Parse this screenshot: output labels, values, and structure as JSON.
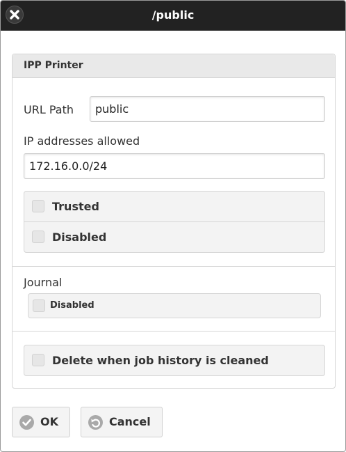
{
  "dialog": {
    "title": "/public",
    "close_icon": "close-icon"
  },
  "panel": {
    "heading": "IPP Printer",
    "url_path_label": "URL Path",
    "url_path_value": "public",
    "ip_label": "IP addresses allowed",
    "ip_value": "172.16.0.0/24",
    "options": [
      {
        "label": "Trusted",
        "checked": false
      },
      {
        "label": "Disabled",
        "checked": false
      }
    ],
    "journal": {
      "label": "Journal",
      "option": {
        "label": "Disabled",
        "checked": false
      }
    },
    "delete_option": {
      "label": "Delete when job history is cleaned",
      "checked": false
    }
  },
  "buttons": {
    "ok_label": "OK",
    "ok_icon": "check-icon",
    "cancel_label": "Cancel",
    "cancel_icon": "undo-icon"
  }
}
